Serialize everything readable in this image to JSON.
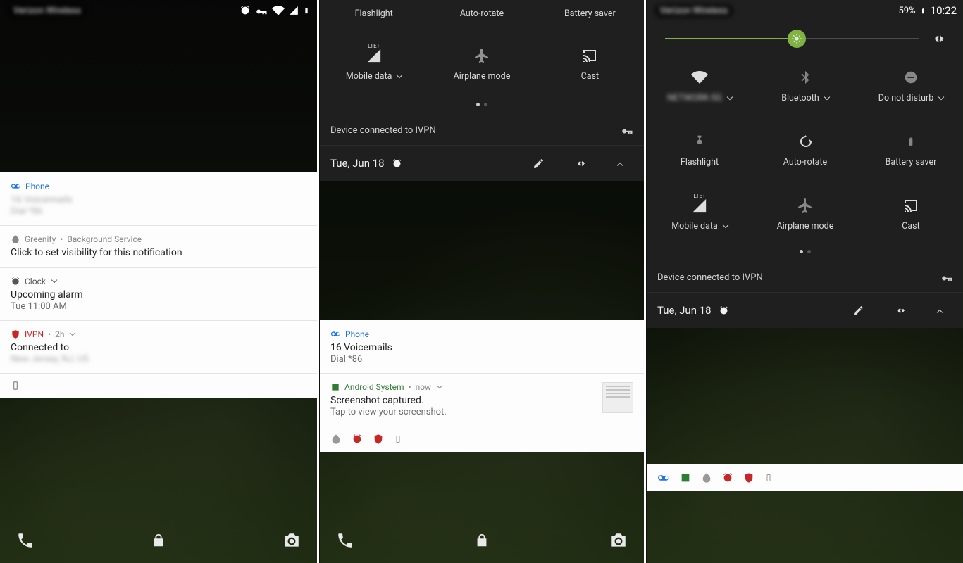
{
  "time": "10:22",
  "date_short": "Tue, Jun 18",
  "alarm_time": "Tue 11:00 AM",
  "battery_pct": "59%",
  "vpn_text": "Device connected to IVPN",
  "p1": {
    "carrier": "Verizon Wireless",
    "notifs": {
      "phone": {
        "app": "Phone",
        "line1": "16 Voicemails",
        "line2": "Dial *86"
      },
      "greenify": {
        "app": "Greenify",
        "meta": "Background Service",
        "body": "Click to set visibility for this notification"
      },
      "clock": {
        "app": "Clock",
        "title": "Upcoming alarm",
        "time": "Tue 11:00 AM"
      },
      "ivpn": {
        "app": "IVPN",
        "meta": "2h",
        "title": "Connected to",
        "server": "New Jersey, NJ, US"
      }
    }
  },
  "p2": {
    "tiles_top": [
      "Flashlight",
      "Auto-rotate",
      "Battery saver"
    ],
    "tiles_mid": [
      "Mobile data",
      "Airplane mode",
      "Cast"
    ],
    "lte": "LTE+",
    "notifs": {
      "phone": {
        "app": "Phone",
        "title": "16 Voicemails",
        "sub": "Dial *86"
      },
      "sys": {
        "app": "Android System",
        "meta": "now",
        "title": "Screenshot captured.",
        "sub": "Tap to view your screenshot."
      }
    }
  },
  "p3": {
    "carrier": "Verizon Wireless",
    "wifi_name": "NETWORK-5G",
    "tiles_r1": [
      "",
      "Bluetooth",
      "Do not disturb"
    ],
    "tiles_r2": [
      "Flashlight",
      "Auto-rotate",
      "Battery saver"
    ],
    "tiles_r3": [
      "Mobile data",
      "Airplane mode",
      "Cast"
    ],
    "lte": "LTE+"
  }
}
